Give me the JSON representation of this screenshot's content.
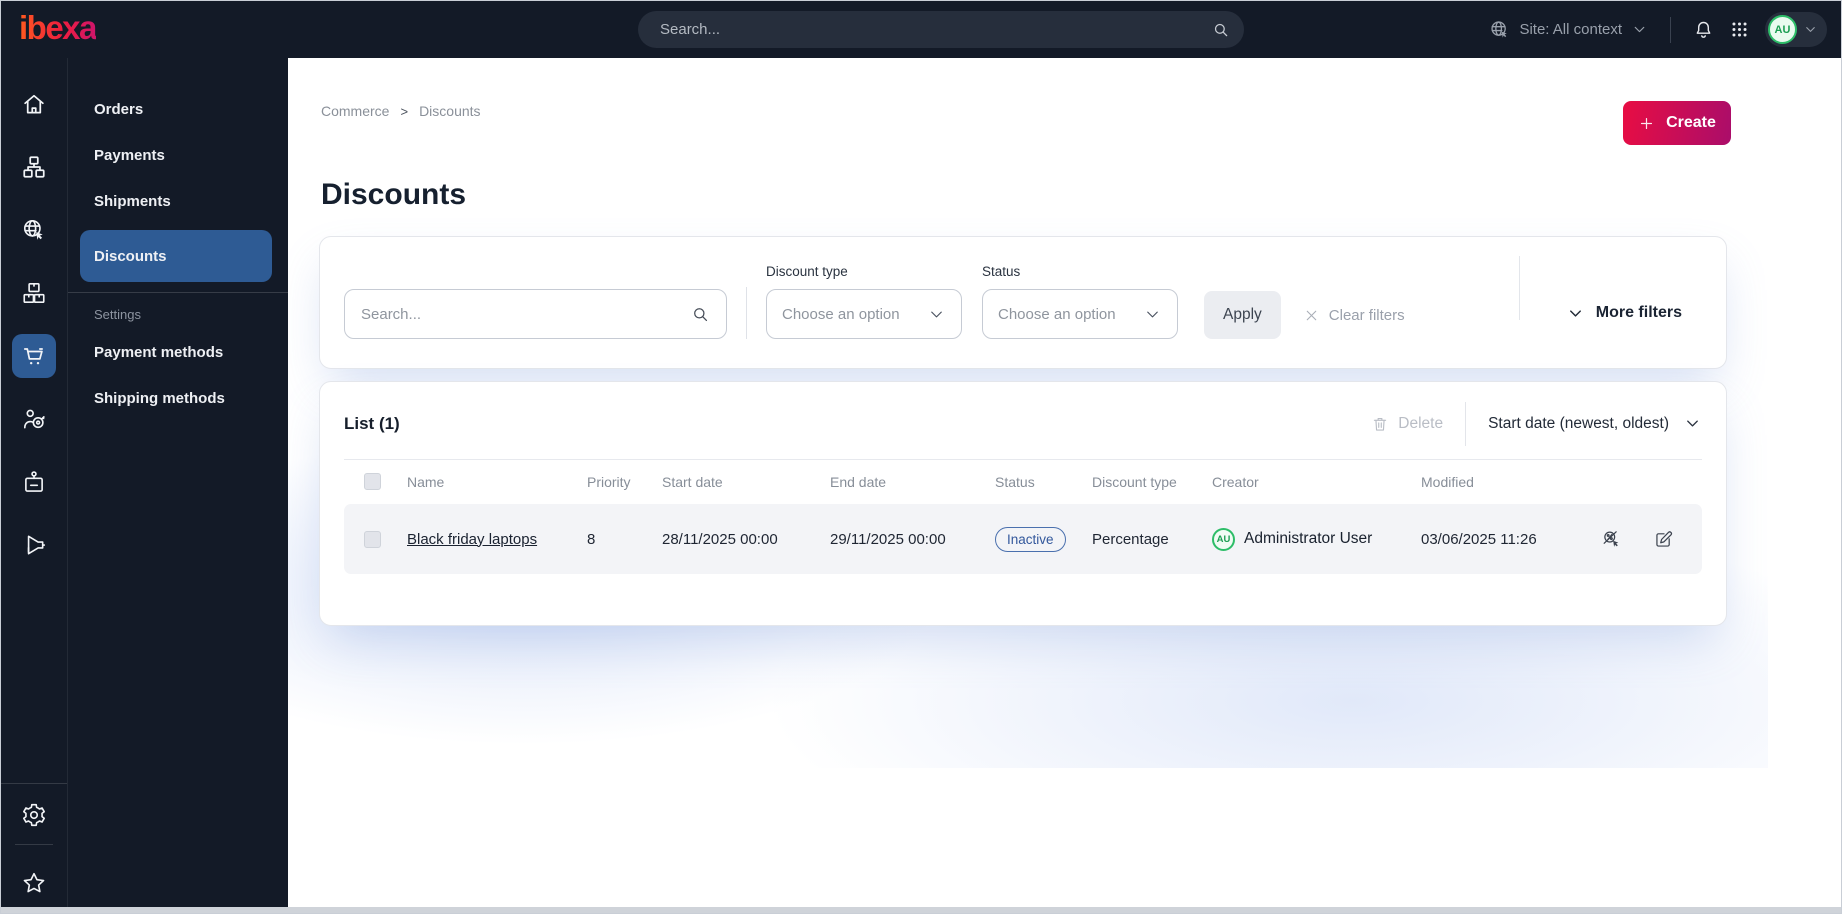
{
  "topbar": {
    "logo_text": "ibexa",
    "search_placeholder": "Search...",
    "site_context_label": "Site: All context",
    "user_initials": "AU"
  },
  "sidebar": {
    "items": [
      {
        "label": "Orders"
      },
      {
        "label": "Payments"
      },
      {
        "label": "Shipments"
      },
      {
        "label": "Discounts"
      }
    ],
    "active_item": "Discounts",
    "settings_heading": "Settings",
    "settings_items": [
      {
        "label": "Payment methods"
      },
      {
        "label": "Shipping methods"
      }
    ]
  },
  "breadcrumb": {
    "items": [
      "Commerce",
      "Discounts"
    ],
    "separator": ">"
  },
  "page": {
    "title": "Discounts"
  },
  "actions": {
    "create_label": "Create"
  },
  "filters": {
    "search_placeholder": "Search...",
    "discount_type_label": "Discount type",
    "discount_type_value": "Choose an option",
    "status_label": "Status",
    "status_value": "Choose an option",
    "apply_label": "Apply",
    "clear_label": "Clear filters",
    "more_filters_label": "More filters"
  },
  "list": {
    "title": "List (1)",
    "delete_label": "Delete",
    "sort_label": "Start date (newest, oldest)",
    "columns": [
      "Name",
      "Priority",
      "Start date",
      "End date",
      "Status",
      "Discount type",
      "Creator",
      "Modified"
    ],
    "rows": [
      {
        "name": "Black friday laptops",
        "priority": "8",
        "start_date": "28/11/2025 00:00",
        "end_date": "29/11/2025 00:00",
        "status": "Inactive",
        "discount_type": "Percentage",
        "creator": "Administrator User",
        "creator_initials": "AU",
        "modified": "03/06/2025 11:26"
      }
    ]
  },
  "colors": {
    "topbar_bg": "#131a27",
    "active_blue": "#2e5b94",
    "accent_gradient_start": "#e80d43",
    "accent_gradient_end": "#aa0d6a",
    "badge_blue": "#33589c",
    "avatar_green": "#2dbd68"
  }
}
